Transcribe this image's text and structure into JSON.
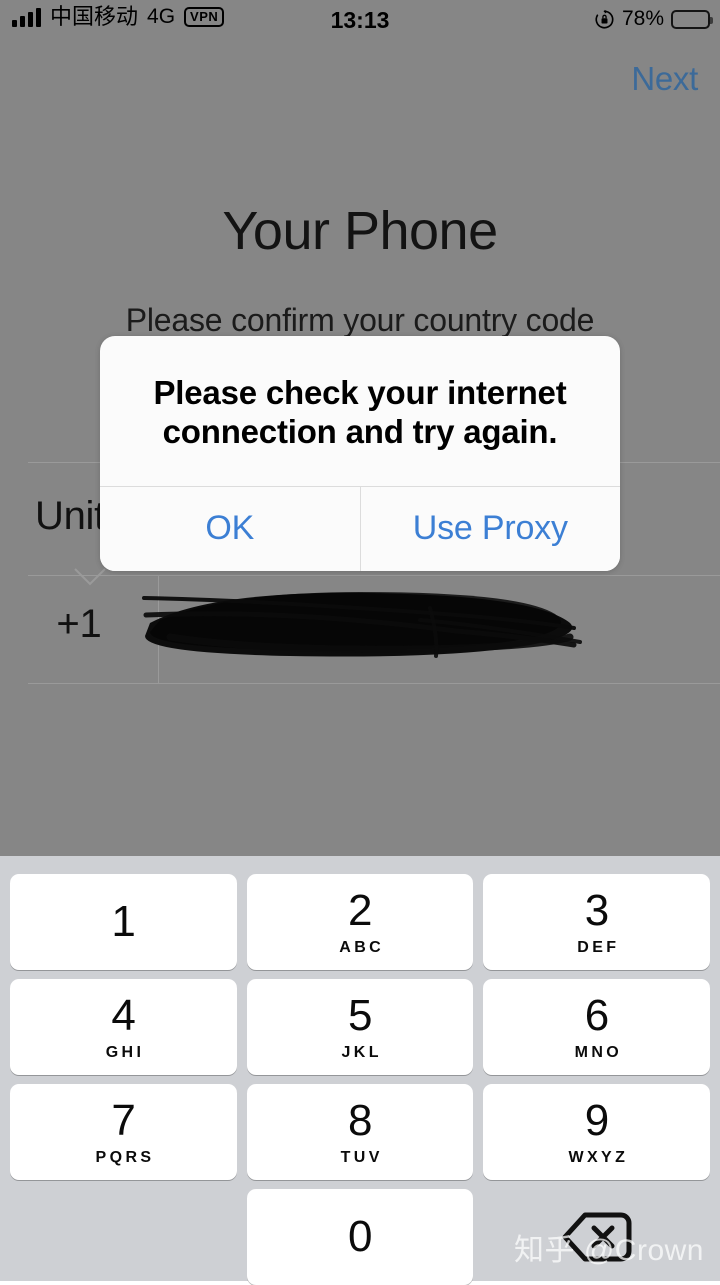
{
  "status_bar": {
    "carrier": "中国移动",
    "network": "4G",
    "vpn_label": "VPN",
    "time": "13:13",
    "battery_percent": "78%",
    "rotation_lock_icon": "rotation-lock-icon",
    "signal_icon": "signal-bars-icon",
    "battery_icon": "battery-full-icon"
  },
  "nav": {
    "next_label": "Next"
  },
  "page": {
    "title": "Your Phone",
    "subtitle": "Please confirm your country code"
  },
  "form": {
    "country_name": "United States",
    "dial_code": "+1",
    "phone_number": "",
    "phone_number_redacted": true,
    "caret_icon": "chevron-down-icon"
  },
  "alert": {
    "message": "Please check your internet connection and try again.",
    "buttons": [
      {
        "label": "OK",
        "name": "ok-button"
      },
      {
        "label": "Use Proxy",
        "name": "use-proxy-button"
      }
    ]
  },
  "keypad": {
    "rows": [
      [
        {
          "digit": "1",
          "letters": ""
        },
        {
          "digit": "2",
          "letters": "ABC"
        },
        {
          "digit": "3",
          "letters": "DEF"
        }
      ],
      [
        {
          "digit": "4",
          "letters": "GHI"
        },
        {
          "digit": "5",
          "letters": "JKL"
        },
        {
          "digit": "6",
          "letters": "MNO"
        }
      ],
      [
        {
          "digit": "7",
          "letters": "PQRS"
        },
        {
          "digit": "8",
          "letters": "TUV"
        },
        {
          "digit": "9",
          "letters": "WXYZ"
        }
      ],
      [
        {
          "digit": "0",
          "letters": ""
        }
      ]
    ],
    "backspace_icon": "backspace-delete-icon"
  },
  "watermark": {
    "text": "知乎 @Crown"
  },
  "colors": {
    "dim_overlay": "#868686",
    "alert_bg": "#fbfbfb",
    "accent_blue": "#3c7fd4",
    "nav_blue_dimmed": "#3c6a99",
    "keypad_bg": "#ced0d4",
    "key_bg": "#ffffff"
  }
}
